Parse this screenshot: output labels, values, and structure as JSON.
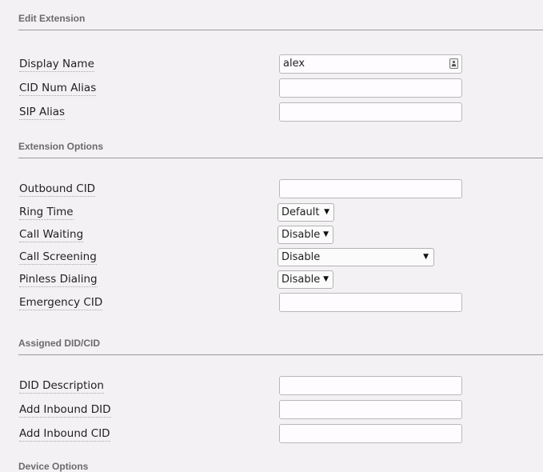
{
  "sections": {
    "edit_extension": "Edit Extension",
    "extension_options": "Extension Options",
    "assigned_did": "Assigned DID/CID",
    "device_options": "Device Options"
  },
  "fields": {
    "display_name": {
      "label": "Display Name",
      "value": "alex"
    },
    "cid_num_alias": {
      "label": "CID Num Alias",
      "value": ""
    },
    "sip_alias": {
      "label": "SIP Alias",
      "value": ""
    },
    "outbound_cid": {
      "label": "Outbound CID",
      "value": ""
    },
    "ring_time": {
      "label": "Ring Time",
      "selected": "Default"
    },
    "call_waiting": {
      "label": "Call Waiting",
      "selected": "Disable"
    },
    "call_screening": {
      "label": "Call Screening",
      "selected": "Disable"
    },
    "pinless_dialing": {
      "label": "Pinless Dialing",
      "selected": "Disable"
    },
    "emergency_cid": {
      "label": "Emergency CID",
      "value": ""
    },
    "did_description": {
      "label": "DID Description",
      "value": ""
    },
    "add_inbound_did": {
      "label": "Add Inbound DID",
      "value": ""
    },
    "add_inbound_cid": {
      "label": "Add Inbound CID",
      "value": ""
    }
  },
  "icons": {
    "dropdown_arrow": "▼",
    "contact_picker": "contact-card-icon"
  },
  "colors": {
    "page_background": "#f4f1f4",
    "input_background": "#fffcff",
    "section_header": "#6b6b6b"
  }
}
